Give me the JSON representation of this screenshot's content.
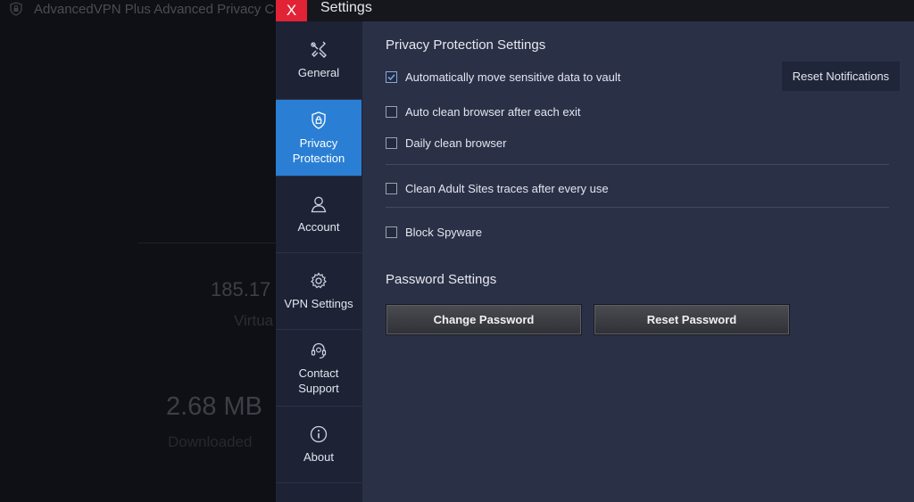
{
  "background_app": {
    "title": "AdvancedVPN Plus Advanced Privacy C",
    "ip_value": "185.17",
    "ip_label": "Virtua",
    "downloaded_value": "2.68 MB",
    "downloaded_label": "Downloaded"
  },
  "window": {
    "title": "Settings",
    "close_label": "X"
  },
  "sidebar": {
    "items": [
      {
        "label": "General",
        "icon": "tools-icon"
      },
      {
        "label": "Privacy\nProtection",
        "icon": "shield-lock-icon",
        "active": true
      },
      {
        "label": "Account",
        "icon": "user-icon"
      },
      {
        "label": "VPN Settings",
        "icon": "gear-icon"
      },
      {
        "label": "Contact\nSupport",
        "icon": "headset-icon"
      },
      {
        "label": "About",
        "icon": "info-icon"
      }
    ]
  },
  "privacy": {
    "title": "Privacy Protection Settings",
    "reset_notifications": "Reset Notifications",
    "options": [
      {
        "label": "Automatically move sensitive data to vault",
        "checked": true
      },
      {
        "label": "Auto clean browser after each exit",
        "checked": false
      },
      {
        "label": "Daily clean browser",
        "checked": false
      },
      {
        "label": "Clean Adult Sites traces after every use",
        "checked": false
      },
      {
        "label": "Block Spyware",
        "checked": false
      }
    ]
  },
  "password": {
    "title": "Password Settings",
    "change_label": "Change Password",
    "reset_label": "Reset Password"
  },
  "colors": {
    "accent": "#2a7fd4",
    "close": "#e22335",
    "panel": "#2a3147",
    "sidebar": "#1d2235"
  }
}
